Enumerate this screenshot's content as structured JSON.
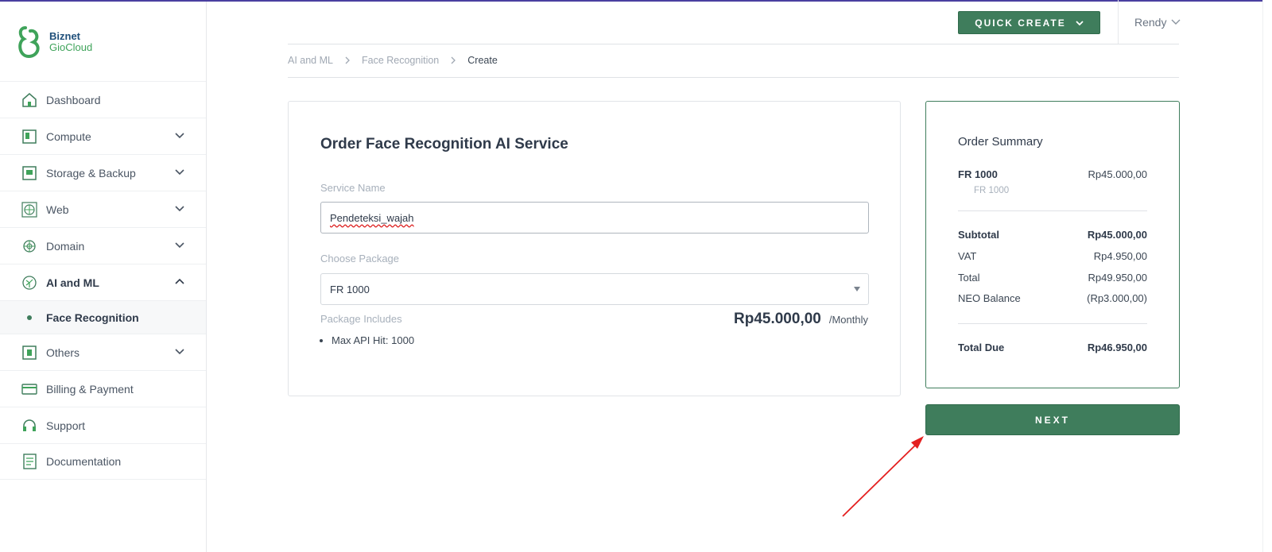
{
  "brand": {
    "line1": "Biznet",
    "line2": "GioCloud",
    "accent": "#3f7d5c"
  },
  "sidebar": {
    "items": [
      {
        "label": "Dashboard",
        "icon": "house-icon",
        "has_children": false
      },
      {
        "label": "Compute",
        "icon": "compute-icon",
        "has_children": true
      },
      {
        "label": "Storage & Backup",
        "icon": "storage-icon",
        "has_children": true
      },
      {
        "label": "Web",
        "icon": "globe-icon",
        "has_children": true
      },
      {
        "label": "Domain",
        "icon": "domain-icon",
        "has_children": true
      },
      {
        "label": "AI and ML",
        "icon": "brain-icon",
        "has_children": true,
        "expanded": true
      },
      {
        "label": "Others",
        "icon": "others-icon",
        "has_children": true
      },
      {
        "label": "Billing & Payment",
        "icon": "card-icon",
        "has_children": false
      },
      {
        "label": "Support",
        "icon": "headset-icon",
        "has_children": false
      },
      {
        "label": "Documentation",
        "icon": "document-icon",
        "has_children": false
      }
    ],
    "sub_item": {
      "label": "Face Recognition"
    }
  },
  "header": {
    "quick_create": "QUICK CREATE",
    "user": "Rendy"
  },
  "breadcrumb": [
    "AI and ML",
    "Face Recognition",
    "Create"
  ],
  "form": {
    "title": "Order Face Recognition AI Service",
    "service_name_label": "Service Name",
    "service_name_value": "Pendeteksi_wajah",
    "package_label": "Choose Package",
    "package_value": "FR 1000",
    "includes_label": "Package Includes",
    "price": "Rp45.000,00",
    "period": "/Monthly",
    "includes": [
      "Max API Hit: 1000"
    ]
  },
  "summary": {
    "title": "Order Summary",
    "item_name": "FR 1000",
    "item_price": "Rp45.000,00",
    "item_desc": "FR 1000",
    "subtotal_label": "Subtotal",
    "subtotal": "Rp45.000,00",
    "vat_label": "VAT",
    "vat": "Rp4.950,00",
    "total_label": "Total",
    "total": "Rp49.950,00",
    "neo_label": "NEO Balance",
    "neo": "(Rp3.000,00)",
    "due_label": "Total Due",
    "due": "Rp46.950,00"
  },
  "next_label": "NEXT"
}
